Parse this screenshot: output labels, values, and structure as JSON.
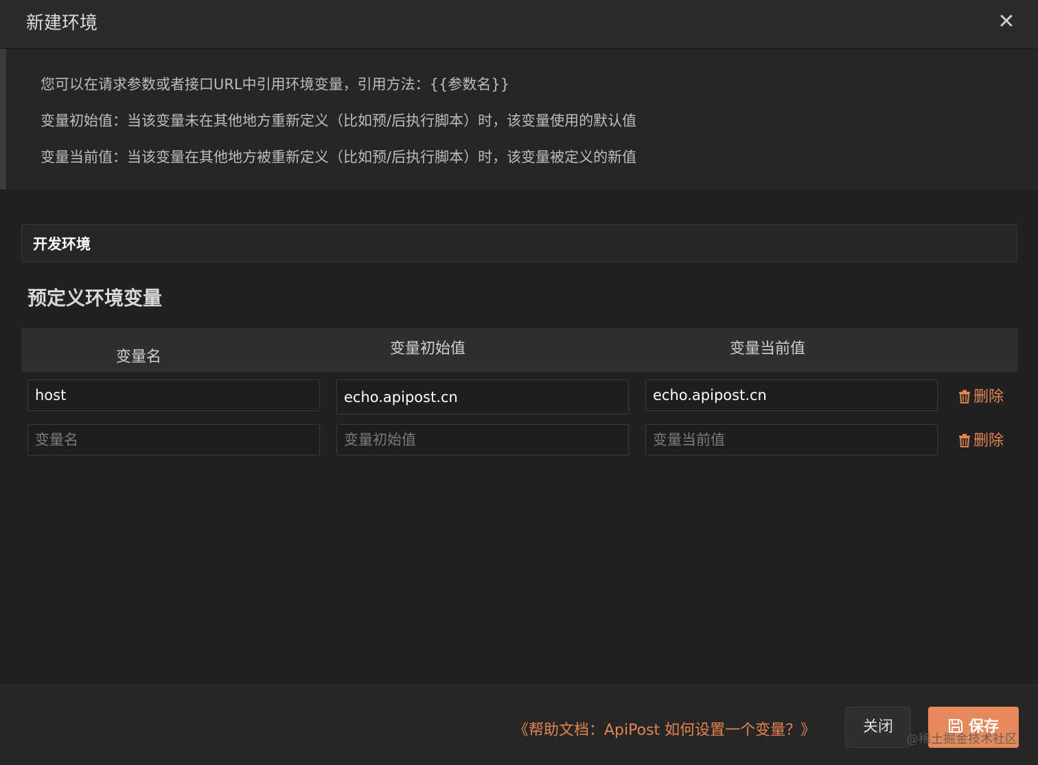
{
  "dialog": {
    "title": "新建环境",
    "close_icon": "close-icon"
  },
  "info": {
    "line1": "您可以在请求参数或者接口URL中引用环境变量，引用方法：{{参数名}}",
    "line2": "变量初始值：当该变量未在其他地方重新定义（比如预/后执行脚本）时，该变量使用的默认值",
    "line3": "变量当前值：当该变量在其他地方被重新定义（比如预/后执行脚本）时，该变量被定义的新值"
  },
  "env_name": {
    "value": "开发环境"
  },
  "section_title": "预定义环境变量",
  "table": {
    "headers": [
      "变量名",
      "变量初始值",
      "变量当前值"
    ],
    "rows": [
      {
        "name": "host",
        "initial": "echo.apipost.cn",
        "current": "echo.apipost.cn",
        "delete_label": "删除"
      },
      {
        "name": "",
        "initial": "",
        "current": "",
        "delete_label": "删除"
      }
    ],
    "placeholders": {
      "name": "变量名",
      "initial": "变量初始值",
      "current": "变量当前值"
    }
  },
  "footer": {
    "help_link": "《帮助文档：ApiPost 如何设置一个变量？》",
    "close_label": "关闭",
    "save_label": "保存",
    "watermark": "@稀土掘金技术社区"
  },
  "colors": {
    "accent": "#e68a5c",
    "background": "#212121"
  }
}
